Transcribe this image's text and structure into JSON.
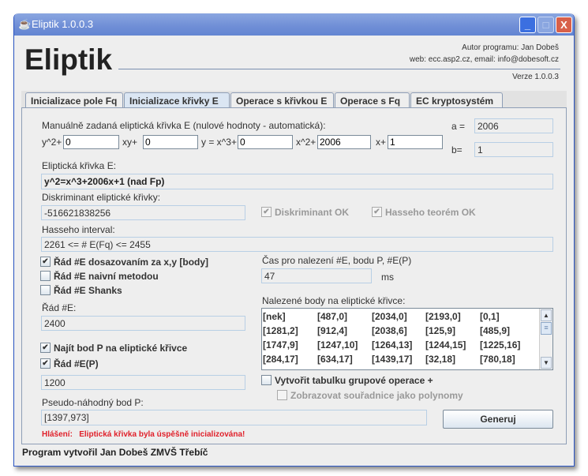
{
  "window": {
    "title": "Eliptik 1.0.0.3",
    "minimize": "_",
    "maximize": "□",
    "close": "X"
  },
  "header": {
    "app_name": "Eliptik",
    "author": "Autor programu: Jan Dobeš",
    "contact": "web: ecc.asp2.cz, email: info@dobesoft.cz",
    "version": "Verze 1.0.0.3"
  },
  "tabs": [
    "Inicializace pole Fq",
    "Inicializace křivky E",
    "Operace s křivkou E",
    "Operace s Fq",
    "EC kryptosystém"
  ],
  "form": {
    "manual_label": "Manuálně zadaná eliptická křivka E (nulové hodnoty - automatická):",
    "y2_label": "y^2+",
    "y2": "0",
    "xy_label": "xy+",
    "xy": "0",
    "x3_label": "y = x^3+",
    "x3": "0",
    "x2_label": "x^2+",
    "x2": "2006",
    "x_label": "x+",
    "x": "1",
    "a_label": "a =",
    "a": "2006",
    "b_label": "b=",
    "b": "1",
    "curve_label": "Eliptická křivka E:",
    "curve": "y^2=x^3+2006x+1 (nad Fp)",
    "disc_label": "Diskriminant eliptické křivky:",
    "disc": "-516621838256",
    "disc_ok": "Diskriminant OK",
    "hasse_ok": "Hasseho teorém OK",
    "hasse_label": "Hasseho interval:",
    "hasse": "2261 <= # E(Fq) <= 2455",
    "opt1": "Řád #E dosazovaním za x,y [body]",
    "opt2": "Řád #E naivní metodou",
    "opt3": "Řád #E Shanks",
    "order_label": "Řád #E:",
    "order": "2400",
    "find_p": "Najít bod P na eliptické křivce",
    "order_p": "Řád #E(P)",
    "order_p_value": "1200",
    "point_label": "Pseudo-náhodný bod P:",
    "point": "[1397,973]",
    "message": "Hlášení:   Eliptická křivka byla úspěšně inicializována!",
    "time_label": "Čas pro nalezení #E, bodu P, #E(P)",
    "time": "47",
    "time_unit": "ms",
    "points_label": "Nalezené body na eliptické křivce:",
    "points": [
      [
        "[nek]",
        "[487,0]",
        "[2034,0]",
        "[2193,0]",
        "[0,1]"
      ],
      [
        "[1281,2]",
        "[912,4]",
        "[2038,6]",
        "[125,9]",
        "[485,9]"
      ],
      [
        "[1747,9]",
        "[1247,10]",
        "[1264,13]",
        "[1244,15]",
        "[1225,16]"
      ],
      [
        "[284,17]",
        "[634,17]",
        "[1439,17]",
        "[32,18]",
        "[780,18]"
      ]
    ],
    "group_table": "Vytvořit tabulku grupové operace +",
    "polynomials": "Zobrazovat souřadnice jako polynomy",
    "generate": "Generuj"
  },
  "footer": "Program vytvořil Jan Dobeš ZMVŠ Třebíč"
}
